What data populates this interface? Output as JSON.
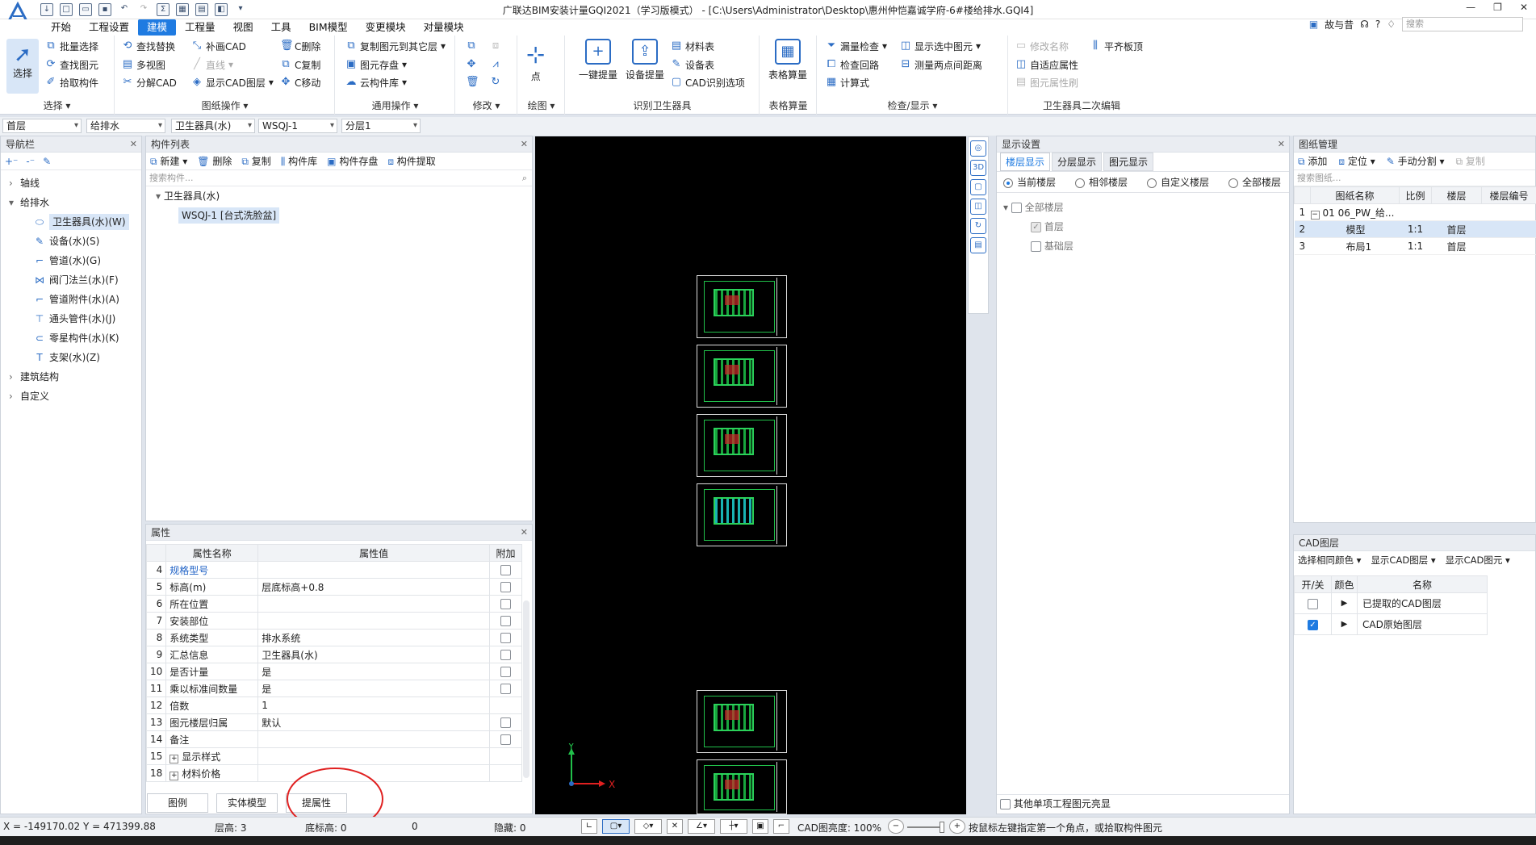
{
  "window": {
    "title": "广联达BIM安装计量GQI2021（学习版模式） - [C:\\Users\\Administrator\\Desktop\\惠州仲恺嘉诚学府-6#楼给排水.GQI4]",
    "controls": [
      "—",
      "❐",
      "✕"
    ]
  },
  "menu": {
    "items": [
      "开始",
      "工程设置",
      "建模",
      "工程量",
      "视图",
      "工具",
      "BIM模型",
      "变更模块",
      "对量模块"
    ],
    "active_index": 2,
    "user": "故与昔",
    "help": "?",
    "search_placeholder": "搜索"
  },
  "ribbon": {
    "select": {
      "label": "选择",
      "big": "选择",
      "batch": "批量选择",
      "find_elem": "查找图元",
      "pick": "拾取构件"
    },
    "drawing": {
      "label": "图纸操作",
      "find_replace": "查找替换",
      "multi_view": "多视图",
      "split_cad": "分解CAD",
      "fill_cad": "补画CAD",
      "line": "直线",
      "show_cad_layer": "显示CAD图层",
      "c_delete": "C删除",
      "c_copy": "C复制",
      "c_move": "C移动"
    },
    "general": {
      "label": "通用操作",
      "copy_to_floor": "复制图元到其它层",
      "save_elem": "图元存盘",
      "cloud_lib": "云构件库"
    },
    "modify": {
      "label": "修改"
    },
    "draw": {
      "label": "绘图",
      "point": "点"
    },
    "identify": {
      "label": "识别卫生器具",
      "one_key": "一键提量",
      "device_extract": "设备提量",
      "material_table": "材料表",
      "device_table": "设备表",
      "cad_options": "CAD识别选项"
    },
    "table_calc": {
      "label": "表格算量",
      "big": "表格算量"
    },
    "check": {
      "label": "检查/显示",
      "leak_check": "漏量检查",
      "check_loop": "检查回路",
      "formula": "计算式",
      "show_selected": "显示选中图元",
      "measure": "测量两点间距离"
    },
    "edit2": {
      "label": "卫生器具二次编辑",
      "rename": "修改名称",
      "adapt": "自适应属性",
      "elem_prop": "图元属性刷",
      "flush": "平齐板顶"
    }
  },
  "selectors": [
    "首层",
    "给排水",
    "卫生器具(水)",
    "WSQJ-1",
    "分层1"
  ],
  "nav": {
    "title": "导航栏",
    "items": [
      {
        "label": "轴线",
        "level": 0,
        "toggle": "›"
      },
      {
        "label": "给排水",
        "level": 0,
        "toggle": "▾"
      },
      {
        "label": "卫生器具(水)(W)",
        "level": 1,
        "icon": "⬭",
        "selected": true
      },
      {
        "label": "设备(水)(S)",
        "level": 1,
        "icon": "✎"
      },
      {
        "label": "管道(水)(G)",
        "level": 1,
        "icon": "⌐"
      },
      {
        "label": "阀门法兰(水)(F)",
        "level": 1,
        "icon": "⋈"
      },
      {
        "label": "管道附件(水)(A)",
        "level": 1,
        "icon": "⌐"
      },
      {
        "label": "通头管件(水)(J)",
        "level": 1,
        "icon": "⊤"
      },
      {
        "label": "零星构件(水)(K)",
        "level": 1,
        "icon": "⊂"
      },
      {
        "label": "支架(水)(Z)",
        "level": 1,
        "icon": "T"
      },
      {
        "label": "建筑结构",
        "level": 0,
        "toggle": "›"
      },
      {
        "label": "自定义",
        "level": 0,
        "toggle": "›"
      }
    ]
  },
  "component_list": {
    "title": "构件列表",
    "toolbar": [
      "新建",
      "删除",
      "复制",
      "构件库",
      "构件存盘",
      "构件提取"
    ],
    "search_placeholder": "搜索构件...",
    "group": "卫生器具(水)",
    "item": "WSQJ-1 [台式洗脸盆]"
  },
  "properties": {
    "title": "属性",
    "headers": [
      "",
      "属性名称",
      "属性值",
      "附加"
    ],
    "rows": [
      {
        "n": "4",
        "name": "规格型号",
        "value": "",
        "attach": true,
        "link": true
      },
      {
        "n": "5",
        "name": "标高(m)",
        "value": "层底标高+0.8",
        "attach": true
      },
      {
        "n": "6",
        "name": "所在位置",
        "value": "",
        "attach": true
      },
      {
        "n": "7",
        "name": "安装部位",
        "value": "",
        "attach": true
      },
      {
        "n": "8",
        "name": "系统类型",
        "value": "排水系统",
        "attach": true
      },
      {
        "n": "9",
        "name": "汇总信息",
        "value": "卫生器具(水)",
        "attach": true
      },
      {
        "n": "10",
        "name": "是否计量",
        "value": "是",
        "attach": true
      },
      {
        "n": "11",
        "name": "乘以标准间数量",
        "value": "是",
        "attach": true
      },
      {
        "n": "12",
        "name": "倍数",
        "value": "1",
        "attach": false
      },
      {
        "n": "13",
        "name": "图元楼层归属",
        "value": "默认",
        "attach": true
      },
      {
        "n": "14",
        "name": "备注",
        "value": "",
        "attach": true
      },
      {
        "n": "15",
        "name": "显示样式",
        "value": "",
        "attach": false,
        "expand": true
      },
      {
        "n": "18",
        "name": "材料价格",
        "value": "",
        "attach": false,
        "expand": true
      }
    ],
    "tabs": [
      "图例",
      "实体模型",
      "提属性"
    ]
  },
  "display_settings": {
    "title": "显示设置",
    "tabs": [
      "楼层显示",
      "分层显示",
      "图元显示"
    ],
    "radios": [
      "当前楼层",
      "相邻楼层",
      "自定义楼层",
      "全部楼层"
    ],
    "tree": [
      {
        "label": "全部楼层",
        "level": 0
      },
      {
        "label": "首层",
        "level": 1,
        "checked": true
      },
      {
        "label": "基础层",
        "level": 1
      }
    ],
    "footer": "其他单项工程图元亮显"
  },
  "drawing_mgmt": {
    "title": "图纸管理",
    "toolbar": [
      "添加",
      "定位",
      "手动分割",
      "复制"
    ],
    "search_placeholder": "搜索图纸...",
    "headers": [
      "",
      "图纸名称",
      "比例",
      "楼层",
      "楼层编号"
    ],
    "rows": [
      {
        "n": "1",
        "name": "01 06_PW_给...",
        "scale": "",
        "floor": ""
      },
      {
        "n": "2",
        "name": "模型",
        "scale": "1:1",
        "floor": "首层"
      },
      {
        "n": "3",
        "name": "布局1",
        "scale": "1:1",
        "floor": "首层"
      }
    ]
  },
  "cad_layers": {
    "title": "CAD图层",
    "toolbar": [
      "选择相同颜色",
      "显示CAD图层",
      "显示CAD图元"
    ],
    "headers": [
      "开/关",
      "颜色",
      "名称"
    ],
    "rows": [
      {
        "on": false,
        "name": "已提取的CAD图层"
      },
      {
        "on": true,
        "name": "CAD原始图层"
      }
    ]
  },
  "axis": {
    "y": "Y",
    "x": "X"
  },
  "status": {
    "coords": "X = -149170.02 Y = 471399.88",
    "floor_height": "层高: 3",
    "bottom_elev": "底标高: 0",
    "zero": "0",
    "hidden": "隐藏: 0",
    "cad_brightness": "CAD图亮度: 100%",
    "hint": "按鼠标左键指定第一个角点，或拾取构件图元"
  }
}
